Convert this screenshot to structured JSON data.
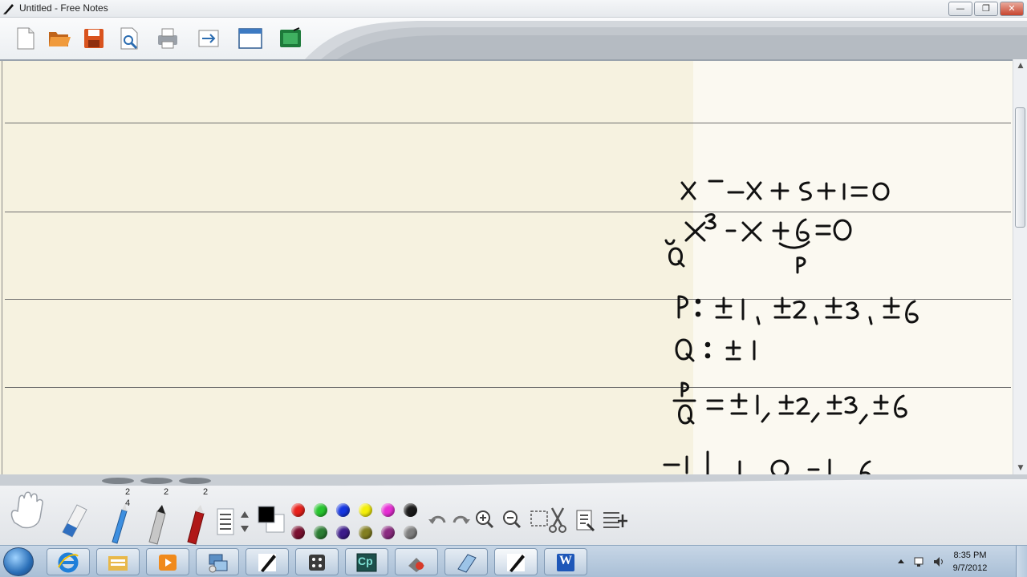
{
  "window": {
    "title": "Untitled - Free Notes",
    "minimize": "—",
    "restore": "❐",
    "close": "✕"
  },
  "toolbar": {
    "buttons": [
      "new-file-icon",
      "open-folder-icon",
      "save-icon",
      "print-preview-icon",
      "print-icon",
      "export-icon",
      "window-icon",
      "capture-icon"
    ]
  },
  "pen_sizes": [
    "2",
    "2",
    "2"
  ],
  "pen_size_sub": "4",
  "colors": {
    "top_row": [
      "#e8211c",
      "#27c52f",
      "#1435e0",
      "#f4ef0a",
      "#e62ed4",
      "#1a1a1a"
    ],
    "bottom_row": [
      "#7a1030",
      "#2b7d33",
      "#3b1a8a",
      "#827e21",
      "#8a2a80",
      "#7d7d7d"
    ],
    "current": "#000000"
  },
  "taskbar": {
    "apps": [
      "internet-explorer-icon",
      "file-explorer-icon",
      "media-player-icon",
      "network-app-icon",
      "free-notes-icon",
      "dice-app-icon",
      "captivate-icon",
      "installer-icon",
      "notepad-icon",
      "free-notes-active-icon",
      "word-icon"
    ],
    "captivate_label": "Cp",
    "word_label": "W",
    "time": "8:35 PM",
    "date": "9/7/2012"
  }
}
